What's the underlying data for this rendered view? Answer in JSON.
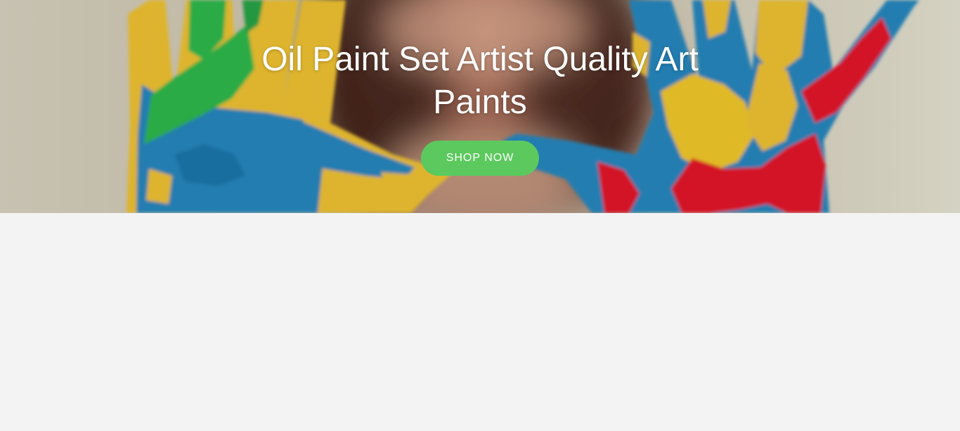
{
  "hero": {
    "title": "Oil Paint Set Artist Quality Art Paints",
    "button_label": "SHOP NOW",
    "image_description": "two hands covered in blue, yellow, green and red paint held up in front of a smiling face",
    "colors": {
      "button": "#5cc95f",
      "title": "#ffffff",
      "page_background": "#f3f3f3"
    }
  },
  "main": {
    "content": ""
  }
}
